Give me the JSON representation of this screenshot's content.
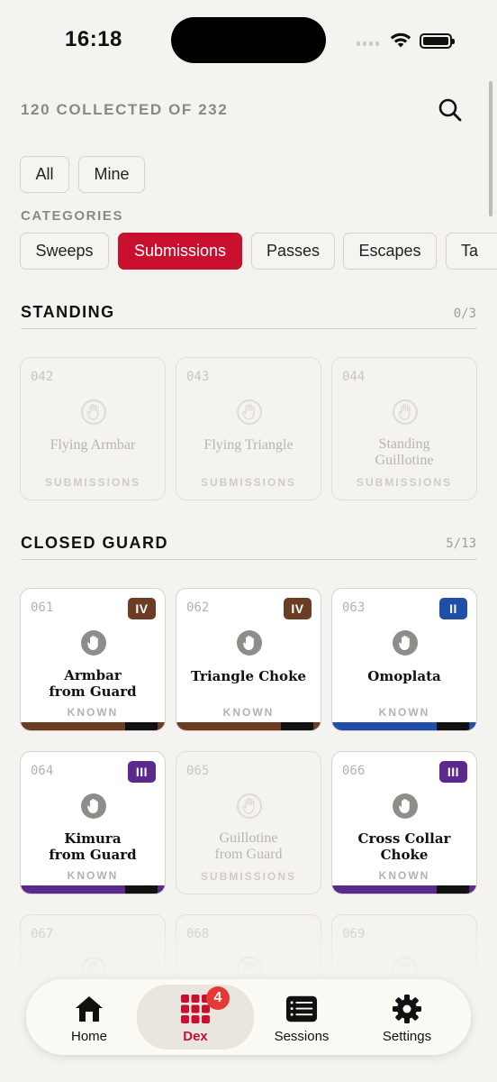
{
  "status": {
    "time": "16:18"
  },
  "header": {
    "collected_text": "120 COLLECTED OF 232"
  },
  "filters": {
    "all": "All",
    "mine": "Mine"
  },
  "categories": {
    "label": "CATEGORIES",
    "items": [
      "Sweeps",
      "Submissions",
      "Passes",
      "Escapes",
      "Ta"
    ],
    "active": "Submissions"
  },
  "sections": [
    {
      "title": "STANDING",
      "count": "0/3",
      "cards": [
        {
          "num": "042",
          "name": "Flying Armbar",
          "label": "SUBMISSIONS"
        },
        {
          "num": "043",
          "name": "Flying Triangle",
          "label": "SUBMISSIONS"
        },
        {
          "num": "044",
          "name": "Standing\nGuillotine",
          "label": "SUBMISSIONS"
        }
      ]
    },
    {
      "title": "CLOSED GUARD",
      "count": "5/13",
      "cards": [
        {
          "num": "061",
          "name": "Armbar\nfrom Guard",
          "label": "KNOWN",
          "rank": "IV",
          "color": "#6b3e23"
        },
        {
          "num": "062",
          "name": "Triangle Choke",
          "label": "KNOWN",
          "rank": "IV",
          "color": "#6b3e23"
        },
        {
          "num": "063",
          "name": "Omoplata",
          "label": "KNOWN",
          "rank": "II",
          "color": "#1f4fa8"
        },
        {
          "num": "064",
          "name": "Kimura\nfrom Guard",
          "label": "KNOWN",
          "rank": "III",
          "color": "#5b2a8c"
        },
        {
          "num": "065",
          "name": "Guillotine\nfrom Guard",
          "label": "SUBMISSIONS"
        },
        {
          "num": "066",
          "name": "Cross Collar\nChoke",
          "label": "KNOWN",
          "rank": "III",
          "color": "#5b2a8c"
        },
        {
          "num": "067"
        },
        {
          "num": "068"
        },
        {
          "num": "069"
        }
      ]
    }
  ],
  "tabbar": {
    "items": [
      {
        "label": "Home",
        "icon": "house-icon"
      },
      {
        "label": "Dex",
        "icon": "grid-icon",
        "badge": "4"
      },
      {
        "label": "Sessions",
        "icon": "list-icon"
      },
      {
        "label": "Settings",
        "icon": "gear-icon"
      }
    ]
  },
  "colors": {
    "accent": "#c8102e",
    "background": "#f5f3ef"
  }
}
